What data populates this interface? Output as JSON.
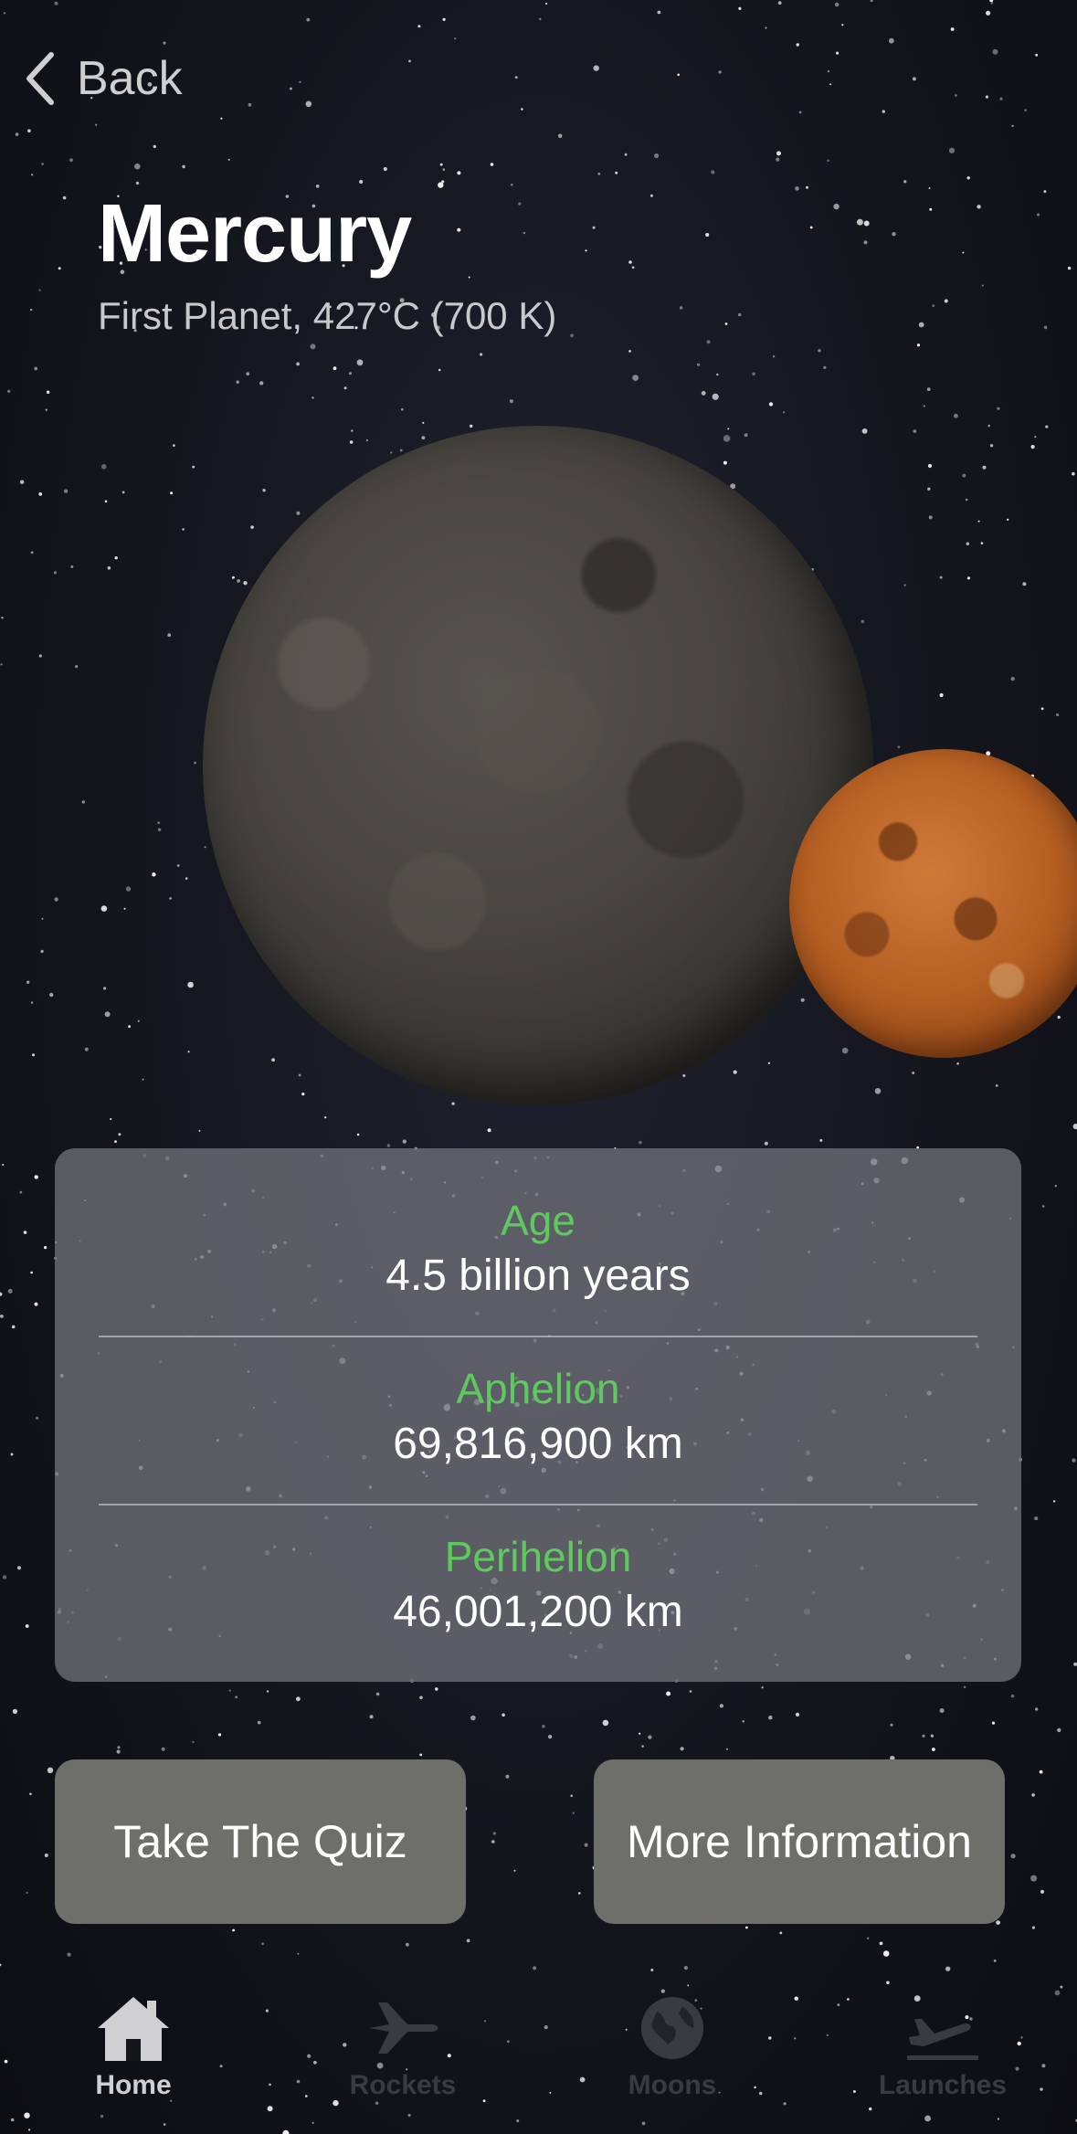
{
  "nav": {
    "back_label": "Back"
  },
  "header": {
    "title": "Mercury",
    "subtitle": "First Planet, 427°C (700 K)"
  },
  "facts": [
    {
      "label": "Age",
      "value": "4.5 billion years"
    },
    {
      "label": "Aphelion",
      "value": "69,816,900 km"
    },
    {
      "label": "Perihelion",
      "value": "46,001,200 km"
    }
  ],
  "actions": {
    "quiz_label": "Take The Quiz",
    "more_info_label": "More Information"
  },
  "tabs": [
    {
      "label": "Home",
      "icon": "house-icon",
      "active": true
    },
    {
      "label": "Rockets",
      "icon": "airplane-icon",
      "active": false
    },
    {
      "label": "Moons",
      "icon": "globe-icon",
      "active": false
    },
    {
      "label": "Launches",
      "icon": "takeoff-icon",
      "active": false
    }
  ],
  "colors": {
    "fact_label": "#5fc85f",
    "card_bg": "#707078",
    "button_bg": "#6e6f6b"
  }
}
